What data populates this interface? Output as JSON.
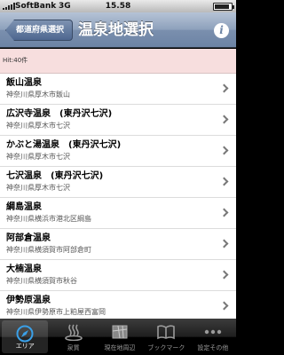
{
  "status": {
    "carrier": "SoftBank",
    "network": "3G",
    "time": "15.58"
  },
  "nav": {
    "back_label": "都道府県選択",
    "title": "温泉地選択",
    "info_glyph": "i"
  },
  "hit_count": "Hit:40件",
  "rows": [
    {
      "name": "飯山温泉",
      "address": "神奈川県厚木市飯山"
    },
    {
      "name": "広沢寺温泉　(東丹沢七沢)",
      "address": "神奈川県厚木市七沢"
    },
    {
      "name": "かぶと湯温泉　(東丹沢七沢)",
      "address": "神奈川県厚木市七沢"
    },
    {
      "name": "七沢温泉　(東丹沢七沢)",
      "address": "神奈川県厚木市七沢"
    },
    {
      "name": "綱島温泉",
      "address": "神奈川県横浜市港北区綱島"
    },
    {
      "name": "阿部倉温泉",
      "address": "神奈川県横須賀市阿部倉町"
    },
    {
      "name": "大楠温泉",
      "address": "神奈川県横須賀市秋谷"
    },
    {
      "name": "伊勢原温泉",
      "address": "神奈川県伊勢原市上粕屋西富岡"
    }
  ],
  "tabs": [
    {
      "label": "エリア",
      "icon": "compass-icon",
      "active": true
    },
    {
      "label": "泉質",
      "icon": "hot-spring-icon",
      "active": false
    },
    {
      "label": "現在地周辺",
      "icon": "map-icon",
      "active": false
    },
    {
      "label": "ブックマーク",
      "icon": "book-icon",
      "active": false
    },
    {
      "label": "設定その他",
      "icon": "more-icon",
      "active": false
    }
  ],
  "colors": {
    "navbar": "#6d84a5",
    "hit_band": "#f7dede",
    "tab_active_icon": "#3aa0e8"
  }
}
